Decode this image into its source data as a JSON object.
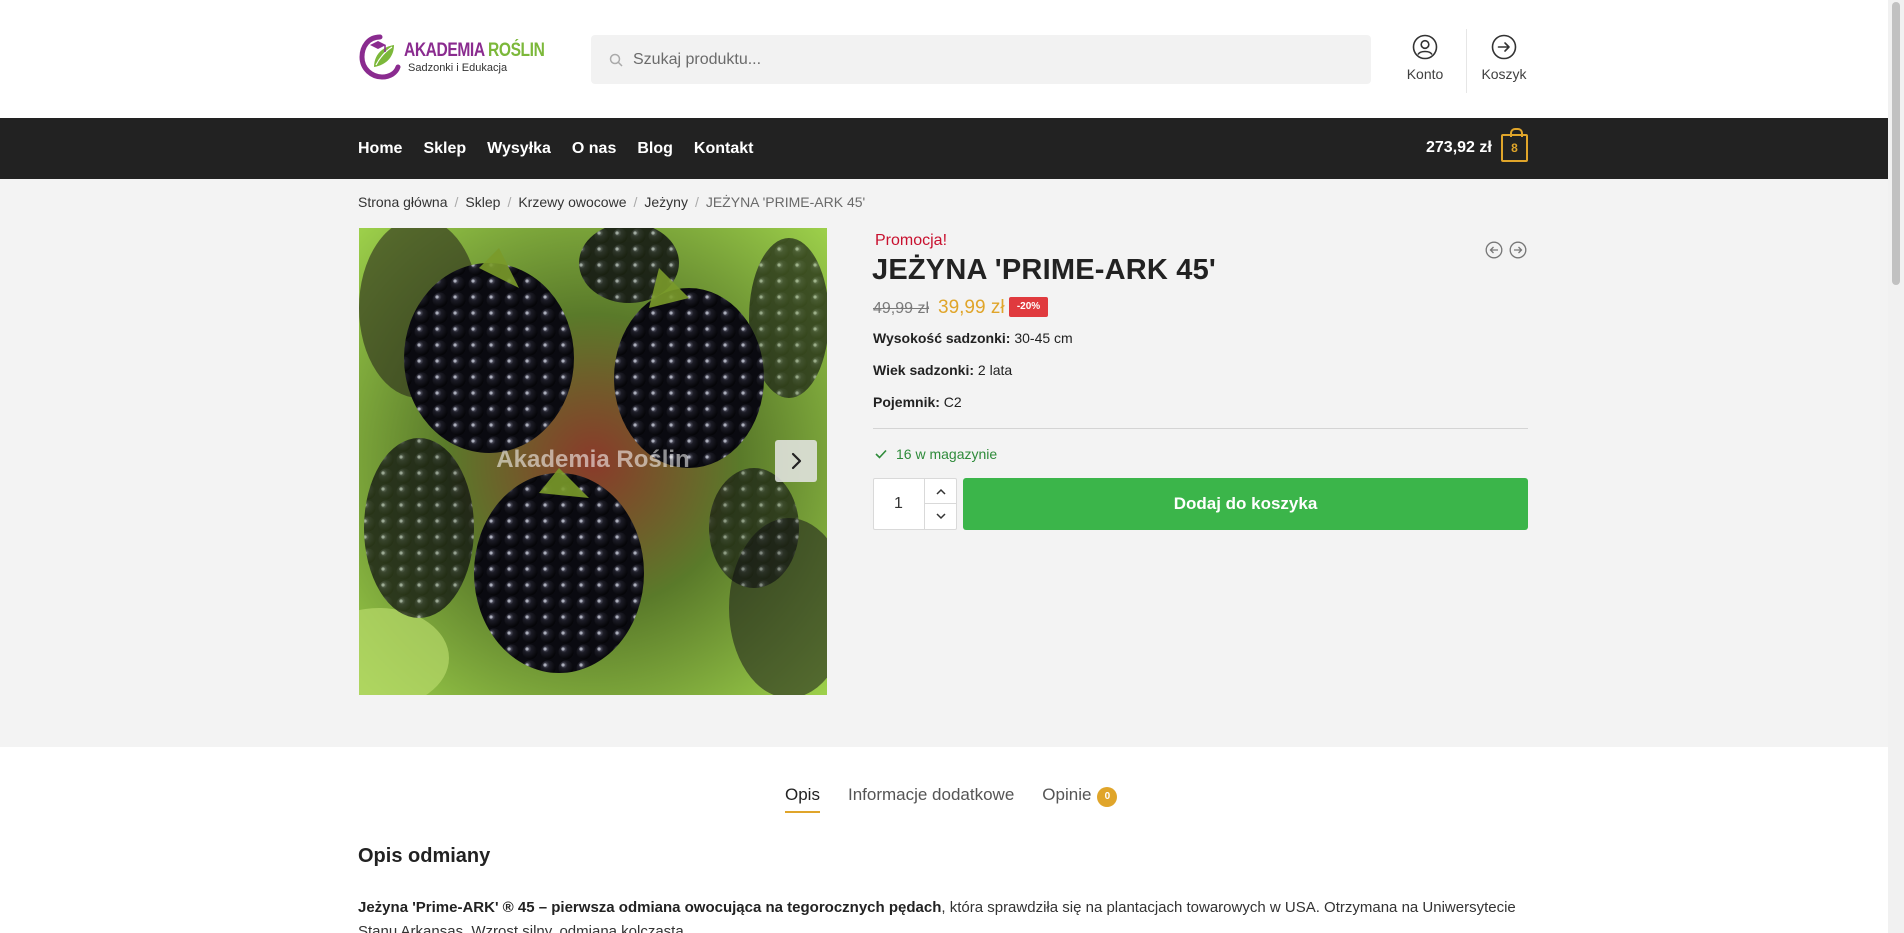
{
  "header": {
    "logo_title_part1": "AKADEMIA ",
    "logo_title_part2": "ROŚLIN",
    "logo_subtitle": "Sadzonki i Edukacja",
    "search_placeholder": "Szukaj produktu...",
    "account_label": "Konto",
    "cart_label": "Koszyk"
  },
  "nav": {
    "items": [
      "Home",
      "Sklep",
      "Wysyłka",
      "O nas",
      "Blog",
      "Kontakt"
    ],
    "cart_total": "273,92 zł",
    "cart_count": "8"
  },
  "breadcrumb": [
    "Strona główna",
    "Sklep",
    "Krzewy owocowe",
    "Jeżyny",
    "JEŻYNA 'PRIME-ARK 45'"
  ],
  "product": {
    "sale_label": "Promocja!",
    "title": "JEŻYNA 'PRIME-ARK 45'",
    "old_price": "49,99 zł",
    "new_price": "39,99 zł",
    "discount": "-20%",
    "image_watermark": "Akademia Roślin",
    "attributes": [
      {
        "label": "Wysokość sadzonki:",
        "value": " 30-45 cm"
      },
      {
        "label": "Wiek sadzonki:",
        "value": " 2 lata"
      },
      {
        "label": "Pojemnik:",
        "value": " C2"
      }
    ],
    "stock": "16 w magazynie",
    "quantity": "1",
    "add_to_cart": "Dodaj do koszyka"
  },
  "tabs": {
    "items": [
      "Opis",
      "Informacje dodatkowe",
      "Opinie"
    ],
    "reviews_count": "0"
  },
  "description": {
    "heading": "Opis odmiany",
    "lead_bold": "Jeżyna 'Prime-ARK' ® 45 – pierwsza odmiana owocująca na tegorocznych pędach",
    "text": ", która sprawdziła się na plantacjach towarowych w USA. Otrzymana na Uniwersytecie Stanu Arkansas. Wzrost silny, odmiana kolczasta."
  },
  "colors": {
    "accent": "#e0a52a",
    "nav_bg": "#222222",
    "button_green": "#3bb54a",
    "sale_red": "#c8102e",
    "discount_red": "#e03a3e"
  }
}
